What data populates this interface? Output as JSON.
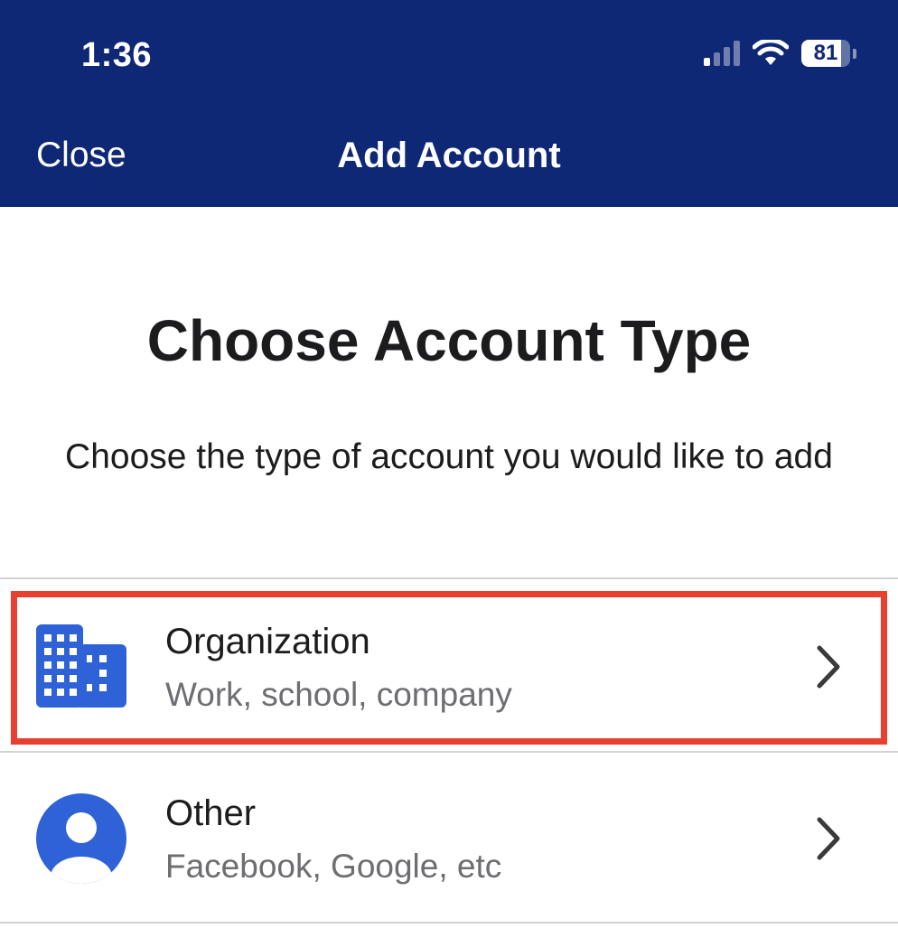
{
  "status_bar": {
    "time": "1:36",
    "battery": "81",
    "battery_level": 0.81,
    "icons": [
      "cellular-signal-icon",
      "wifi-icon",
      "battery-icon"
    ]
  },
  "nav": {
    "close_label": "Close",
    "title": "Add Account"
  },
  "main": {
    "heading": "Choose Account Type",
    "subheading": "Choose the type of account you would like to add"
  },
  "options": [
    {
      "title": "Organization",
      "subtitle": "Work, school, company",
      "icon": "building-icon",
      "highlighted": true
    },
    {
      "title": "Other",
      "subtitle": "Facebook, Google, etc",
      "icon": "person-icon",
      "highlighted": false
    }
  ],
  "colors": {
    "header_bg": "#0f2876",
    "icon_blue": "#2f62d6",
    "highlight_red": "#e8402f",
    "chevron": "#3a3a3c"
  }
}
